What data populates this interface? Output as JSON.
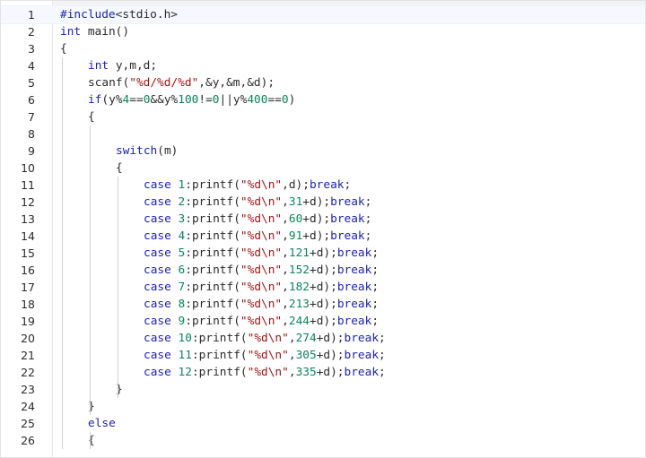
{
  "editor": {
    "colors": {
      "keyword": "#1d22b8",
      "string": "#a31515",
      "number": "#098658",
      "text": "#2b2b2b",
      "current_line_bg": "#f5f9ff"
    },
    "current_line": 1,
    "lines": [
      {
        "number": "1",
        "indent": 0,
        "tokens": [
          {
            "t": "kw",
            "v": "#include"
          },
          {
            "t": "plain",
            "v": "<stdio.h>"
          }
        ]
      },
      {
        "number": "2",
        "indent": 0,
        "tokens": [
          {
            "t": "kw",
            "v": "int"
          },
          {
            "t": "plain",
            "v": " main()"
          }
        ]
      },
      {
        "number": "3",
        "indent": 0,
        "tokens": [
          {
            "t": "plain",
            "v": "{"
          }
        ]
      },
      {
        "number": "4",
        "indent": 1,
        "tokens": [
          {
            "t": "kw",
            "v": "int"
          },
          {
            "t": "plain",
            "v": " y,m,d;"
          }
        ]
      },
      {
        "number": "5",
        "indent": 1,
        "tokens": [
          {
            "t": "plain",
            "v": "scanf("
          },
          {
            "t": "str",
            "v": "\"%d/%d/%d\""
          },
          {
            "t": "plain",
            "v": ",&y,&m,&d);"
          }
        ]
      },
      {
        "number": "6",
        "indent": 1,
        "tokens": [
          {
            "t": "kw",
            "v": "if"
          },
          {
            "t": "plain",
            "v": "(y%"
          },
          {
            "t": "num",
            "v": "4"
          },
          {
            "t": "plain",
            "v": "=="
          },
          {
            "t": "num",
            "v": "0"
          },
          {
            "t": "plain",
            "v": "&&y%"
          },
          {
            "t": "num",
            "v": "100"
          },
          {
            "t": "plain",
            "v": "!="
          },
          {
            "t": "num",
            "v": "0"
          },
          {
            "t": "plain",
            "v": "||y%"
          },
          {
            "t": "num",
            "v": "400"
          },
          {
            "t": "plain",
            "v": "=="
          },
          {
            "t": "num",
            "v": "0"
          },
          {
            "t": "plain",
            "v": ")"
          }
        ]
      },
      {
        "number": "7",
        "indent": 1,
        "tokens": [
          {
            "t": "plain",
            "v": "{"
          }
        ]
      },
      {
        "number": "8",
        "indent": 0,
        "tokens": []
      },
      {
        "number": "9",
        "indent": 2,
        "tokens": [
          {
            "t": "kw",
            "v": "switch"
          },
          {
            "t": "plain",
            "v": "(m)"
          }
        ]
      },
      {
        "number": "10",
        "indent": 2,
        "tokens": [
          {
            "t": "plain",
            "v": "{"
          }
        ]
      },
      {
        "number": "11",
        "indent": 3,
        "tokens": [
          {
            "t": "kw",
            "v": "case"
          },
          {
            "t": "plain",
            "v": " "
          },
          {
            "t": "num",
            "v": "1"
          },
          {
            "t": "plain",
            "v": ":printf("
          },
          {
            "t": "str",
            "v": "\"%d\\n\""
          },
          {
            "t": "plain",
            "v": ",d);"
          },
          {
            "t": "kw",
            "v": "break"
          },
          {
            "t": "plain",
            "v": ";"
          }
        ]
      },
      {
        "number": "12",
        "indent": 3,
        "tokens": [
          {
            "t": "kw",
            "v": "case"
          },
          {
            "t": "plain",
            "v": " "
          },
          {
            "t": "num",
            "v": "2"
          },
          {
            "t": "plain",
            "v": ":printf("
          },
          {
            "t": "str",
            "v": "\"%d\\n\""
          },
          {
            "t": "plain",
            "v": ","
          },
          {
            "t": "num",
            "v": "31"
          },
          {
            "t": "plain",
            "v": "+d);"
          },
          {
            "t": "kw",
            "v": "break"
          },
          {
            "t": "plain",
            "v": ";"
          }
        ]
      },
      {
        "number": "13",
        "indent": 3,
        "tokens": [
          {
            "t": "kw",
            "v": "case"
          },
          {
            "t": "plain",
            "v": " "
          },
          {
            "t": "num",
            "v": "3"
          },
          {
            "t": "plain",
            "v": ":printf("
          },
          {
            "t": "str",
            "v": "\"%d\\n\""
          },
          {
            "t": "plain",
            "v": ","
          },
          {
            "t": "num",
            "v": "60"
          },
          {
            "t": "plain",
            "v": "+d);"
          },
          {
            "t": "kw",
            "v": "break"
          },
          {
            "t": "plain",
            "v": ";"
          }
        ]
      },
      {
        "number": "14",
        "indent": 3,
        "tokens": [
          {
            "t": "kw",
            "v": "case"
          },
          {
            "t": "plain",
            "v": " "
          },
          {
            "t": "num",
            "v": "4"
          },
          {
            "t": "plain",
            "v": ":printf("
          },
          {
            "t": "str",
            "v": "\"%d\\n\""
          },
          {
            "t": "plain",
            "v": ","
          },
          {
            "t": "num",
            "v": "91"
          },
          {
            "t": "plain",
            "v": "+d);"
          },
          {
            "t": "kw",
            "v": "break"
          },
          {
            "t": "plain",
            "v": ";"
          }
        ]
      },
      {
        "number": "15",
        "indent": 3,
        "tokens": [
          {
            "t": "kw",
            "v": "case"
          },
          {
            "t": "plain",
            "v": " "
          },
          {
            "t": "num",
            "v": "5"
          },
          {
            "t": "plain",
            "v": ":printf("
          },
          {
            "t": "str",
            "v": "\"%d\\n\""
          },
          {
            "t": "plain",
            "v": ","
          },
          {
            "t": "num",
            "v": "121"
          },
          {
            "t": "plain",
            "v": "+d);"
          },
          {
            "t": "kw",
            "v": "break"
          },
          {
            "t": "plain",
            "v": ";"
          }
        ]
      },
      {
        "number": "16",
        "indent": 3,
        "tokens": [
          {
            "t": "kw",
            "v": "case"
          },
          {
            "t": "plain",
            "v": " "
          },
          {
            "t": "num",
            "v": "6"
          },
          {
            "t": "plain",
            "v": ":printf("
          },
          {
            "t": "str",
            "v": "\"%d\\n\""
          },
          {
            "t": "plain",
            "v": ","
          },
          {
            "t": "num",
            "v": "152"
          },
          {
            "t": "plain",
            "v": "+d);"
          },
          {
            "t": "kw",
            "v": "break"
          },
          {
            "t": "plain",
            "v": ";"
          }
        ]
      },
      {
        "number": "17",
        "indent": 3,
        "tokens": [
          {
            "t": "kw",
            "v": "case"
          },
          {
            "t": "plain",
            "v": " "
          },
          {
            "t": "num",
            "v": "7"
          },
          {
            "t": "plain",
            "v": ":printf("
          },
          {
            "t": "str",
            "v": "\"%d\\n\""
          },
          {
            "t": "plain",
            "v": ","
          },
          {
            "t": "num",
            "v": "182"
          },
          {
            "t": "plain",
            "v": "+d);"
          },
          {
            "t": "kw",
            "v": "break"
          },
          {
            "t": "plain",
            "v": ";"
          }
        ]
      },
      {
        "number": "18",
        "indent": 3,
        "tokens": [
          {
            "t": "kw",
            "v": "case"
          },
          {
            "t": "plain",
            "v": " "
          },
          {
            "t": "num",
            "v": "8"
          },
          {
            "t": "plain",
            "v": ":printf("
          },
          {
            "t": "str",
            "v": "\"%d\\n\""
          },
          {
            "t": "plain",
            "v": ","
          },
          {
            "t": "num",
            "v": "213"
          },
          {
            "t": "plain",
            "v": "+d);"
          },
          {
            "t": "kw",
            "v": "break"
          },
          {
            "t": "plain",
            "v": ";"
          }
        ]
      },
      {
        "number": "19",
        "indent": 3,
        "tokens": [
          {
            "t": "kw",
            "v": "case"
          },
          {
            "t": "plain",
            "v": " "
          },
          {
            "t": "num",
            "v": "9"
          },
          {
            "t": "plain",
            "v": ":printf("
          },
          {
            "t": "str",
            "v": "\"%d\\n\""
          },
          {
            "t": "plain",
            "v": ","
          },
          {
            "t": "num",
            "v": "244"
          },
          {
            "t": "plain",
            "v": "+d);"
          },
          {
            "t": "kw",
            "v": "break"
          },
          {
            "t": "plain",
            "v": ";"
          }
        ]
      },
      {
        "number": "20",
        "indent": 3,
        "tokens": [
          {
            "t": "kw",
            "v": "case"
          },
          {
            "t": "plain",
            "v": " "
          },
          {
            "t": "num",
            "v": "10"
          },
          {
            "t": "plain",
            "v": ":printf("
          },
          {
            "t": "str",
            "v": "\"%d\\n\""
          },
          {
            "t": "plain",
            "v": ","
          },
          {
            "t": "num",
            "v": "274"
          },
          {
            "t": "plain",
            "v": "+d);"
          },
          {
            "t": "kw",
            "v": "break"
          },
          {
            "t": "plain",
            "v": ";"
          }
        ]
      },
      {
        "number": "21",
        "indent": 3,
        "tokens": [
          {
            "t": "kw",
            "v": "case"
          },
          {
            "t": "plain",
            "v": " "
          },
          {
            "t": "num",
            "v": "11"
          },
          {
            "t": "plain",
            "v": ":printf("
          },
          {
            "t": "str",
            "v": "\"%d\\n\""
          },
          {
            "t": "plain",
            "v": ","
          },
          {
            "t": "num",
            "v": "305"
          },
          {
            "t": "plain",
            "v": "+d);"
          },
          {
            "t": "kw",
            "v": "break"
          },
          {
            "t": "plain",
            "v": ";"
          }
        ]
      },
      {
        "number": "22",
        "indent": 3,
        "tokens": [
          {
            "t": "kw",
            "v": "case"
          },
          {
            "t": "plain",
            "v": " "
          },
          {
            "t": "num",
            "v": "12"
          },
          {
            "t": "plain",
            "v": ":printf("
          },
          {
            "t": "str",
            "v": "\"%d\\n\""
          },
          {
            "t": "plain",
            "v": ","
          },
          {
            "t": "num",
            "v": "335"
          },
          {
            "t": "plain",
            "v": "+d);"
          },
          {
            "t": "kw",
            "v": "break"
          },
          {
            "t": "plain",
            "v": ";"
          }
        ]
      },
      {
        "number": "23",
        "indent": 2,
        "tokens": [
          {
            "t": "plain",
            "v": "}"
          }
        ]
      },
      {
        "number": "24",
        "indent": 1,
        "tokens": [
          {
            "t": "plain",
            "v": "}"
          }
        ]
      },
      {
        "number": "25",
        "indent": 1,
        "tokens": [
          {
            "t": "kw",
            "v": "else"
          }
        ]
      },
      {
        "number": "26",
        "indent": 1,
        "tokens": [
          {
            "t": "plain",
            "v": "{"
          }
        ]
      }
    ]
  }
}
